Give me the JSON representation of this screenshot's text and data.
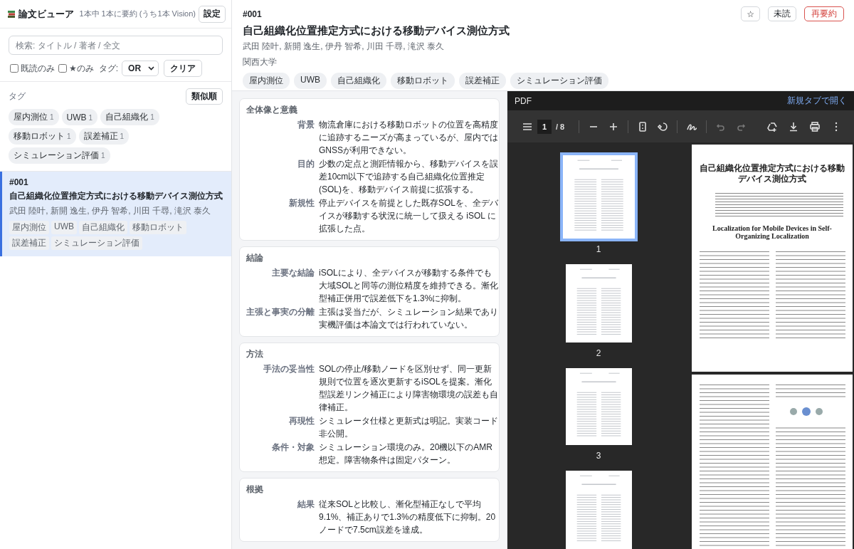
{
  "app": {
    "title": "論文ビューア",
    "status": "1本中 1本に要約 (うち1本 Vision)",
    "settings_button": "設定"
  },
  "search": {
    "placeholder": "検索: タイトル / 著者 / 全文"
  },
  "filters": [
    {
      "label": "既読のみ",
      "checked": false
    },
    {
      "label": "★のみ",
      "checked": false
    }
  ],
  "tag_mode": {
    "label": "タグ:",
    "value": "OR"
  },
  "clear_button": "クリア",
  "tag_panel": {
    "label": "タグ",
    "sort_button": "類似順",
    "tags": [
      {
        "name": "屋内測位",
        "count": "1"
      },
      {
        "name": "UWB",
        "count": "1"
      },
      {
        "name": "自己組織化",
        "count": "1"
      },
      {
        "name": "移動ロボット",
        "count": "1"
      },
      {
        "name": "誤差補正",
        "count": "1"
      },
      {
        "name": "シミュレーション評価",
        "count": "1"
      }
    ]
  },
  "papers": [
    {
      "id": "#001",
      "title": "自己組織化位置推定方式における移動デバイス測位方式",
      "authors": "武田 陸叶, 新開 逸生, 伊丹 智希, 川田 千尋, 滝沢 泰久",
      "tags": [
        "屋内測位",
        "UWB",
        "自己組織化",
        "移動ロボット",
        "誤差補正",
        "シミュレーション評価"
      ],
      "selected": true
    }
  ],
  "detail": {
    "id": "#001",
    "title": "自己組織化位置推定方式における移動デバイス測位方式",
    "authors": "武田 陸叶, 新開 逸生, 伊丹 智希, 川田 千尋, 滝沢 泰久",
    "affiliation": "関西大学",
    "tags": [
      "屋内測位",
      "UWB",
      "自己組織化",
      "移動ロボット",
      "誤差補正",
      "シミュレーション評価"
    ],
    "actions": [
      {
        "kind": "star",
        "label": "☆"
      },
      {
        "kind": "unread",
        "label": "未読"
      },
      {
        "kind": "resummarize",
        "label": "再要約"
      }
    ]
  },
  "sections": [
    {
      "heading": "全体像と意義",
      "rows": [
        {
          "label": "背景",
          "text": "物流倉庫における移動ロボットの位置を高精度に追跡するニーズが高まっているが、屋内ではGNSSが利用できない。"
        },
        {
          "label": "目的",
          "text": "少数の定点と測距情報から、移動デバイスを誤差10cm以下で追跡する自己組織化位置推定(SOL)を、移動デバイス前提に拡張する。"
        },
        {
          "label": "新規性",
          "text": "停止デバイスを前提とした既存SOLを、全デバイスが移動する状況に統一して扱える iSOL に拡張した点。"
        }
      ]
    },
    {
      "heading": "結論",
      "rows": [
        {
          "label": "主要な結論",
          "text": "iSOLにより、全デバイスが移動する条件でも大域SOLと同等の測位精度を維持できる。漸化型補正併用で誤差低下を1.3%に抑制。"
        },
        {
          "label": "主張と事実の分離",
          "text": "主張は妥当だが、シミュレーション結果であり実機評価は本論文では行われていない。"
        }
      ]
    },
    {
      "heading": "方法",
      "rows": [
        {
          "label": "手法の妥当性",
          "text": "SOLの停止/移動ノードを区別せず、同一更新規則で位置を逐次更新するiSOLを提案。漸化型誤差リンク補正により障害物環境の誤差も自律補正。"
        },
        {
          "label": "再現性",
          "text": "シミュレータ仕様と更新式は明記。実装コード非公開。"
        },
        {
          "label": "条件・対象",
          "text": "シミュレーション環境のみ。20機以下のAMR想定。障害物条件は固定パターン。"
        }
      ]
    },
    {
      "heading": "根拠",
      "rows": [
        {
          "label": "結果",
          "text": "従来SOLと比較し、漸化型補正なしで平均9.1%、補正ありで1.3%の精度低下に抑制。20ノードで7.5cm誤差を達成。"
        }
      ]
    }
  ],
  "pdf": {
    "label": "PDF",
    "open_link": "新規タブで開く",
    "page": "1",
    "total": "/ 8",
    "thumbnails": [
      {
        "label": "1",
        "selected": true
      },
      {
        "label": "2",
        "selected": false
      },
      {
        "label": "3",
        "selected": false
      },
      {
        "selected": false
      }
    ],
    "pages": [
      {
        "kind": "title",
        "title": "自己組織化位置推定方式における移動デバイス測位方式",
        "subtitle": "Localization for Mobile Devices in Self-Organizing Localization"
      },
      {
        "kind": "body"
      }
    ]
  }
}
